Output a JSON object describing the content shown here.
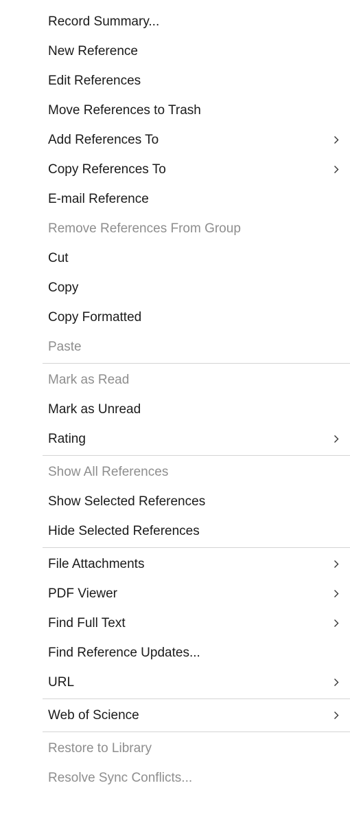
{
  "menu": {
    "items": [
      {
        "label": "Record Summary...",
        "enabled": true,
        "submenu": false
      },
      {
        "label": "New Reference",
        "enabled": true,
        "submenu": false
      },
      {
        "label": "Edit References",
        "enabled": true,
        "submenu": false
      },
      {
        "label": "Move References to Trash",
        "enabled": true,
        "submenu": false
      },
      {
        "label": "Add References To",
        "enabled": true,
        "submenu": true
      },
      {
        "label": "Copy References To",
        "enabled": true,
        "submenu": true
      },
      {
        "label": "E-mail Reference",
        "enabled": true,
        "submenu": false
      },
      {
        "label": "Remove References From Group",
        "enabled": false,
        "submenu": false
      },
      {
        "label": "Cut",
        "enabled": true,
        "submenu": false
      },
      {
        "label": "Copy",
        "enabled": true,
        "submenu": false
      },
      {
        "label": "Copy Formatted",
        "enabled": true,
        "submenu": false
      },
      {
        "label": "Paste",
        "enabled": false,
        "submenu": false
      },
      {
        "label": "Mark as Read",
        "enabled": false,
        "submenu": false
      },
      {
        "label": "Mark as Unread",
        "enabled": true,
        "submenu": false
      },
      {
        "label": "Rating",
        "enabled": true,
        "submenu": true
      },
      {
        "label": "Show All References",
        "enabled": false,
        "submenu": false
      },
      {
        "label": "Show Selected References",
        "enabled": true,
        "submenu": false
      },
      {
        "label": "Hide Selected References",
        "enabled": true,
        "submenu": false
      },
      {
        "label": "File Attachments",
        "enabled": true,
        "submenu": true
      },
      {
        "label": "PDF Viewer",
        "enabled": true,
        "submenu": true
      },
      {
        "label": "Find Full Text",
        "enabled": true,
        "submenu": true
      },
      {
        "label": "Find Reference Updates...",
        "enabled": true,
        "submenu": false
      },
      {
        "label": "URL",
        "enabled": true,
        "submenu": true
      },
      {
        "label": "Web of Science",
        "enabled": true,
        "submenu": true
      },
      {
        "label": "Restore to Library",
        "enabled": false,
        "submenu": false
      },
      {
        "label": "Resolve Sync Conflicts...",
        "enabled": false,
        "submenu": false
      }
    ]
  },
  "colors": {
    "enabled_text": "#1a1a1a",
    "disabled_text": "#8e8e8e",
    "separator": "#d4d4d4",
    "background": "#ffffff"
  }
}
